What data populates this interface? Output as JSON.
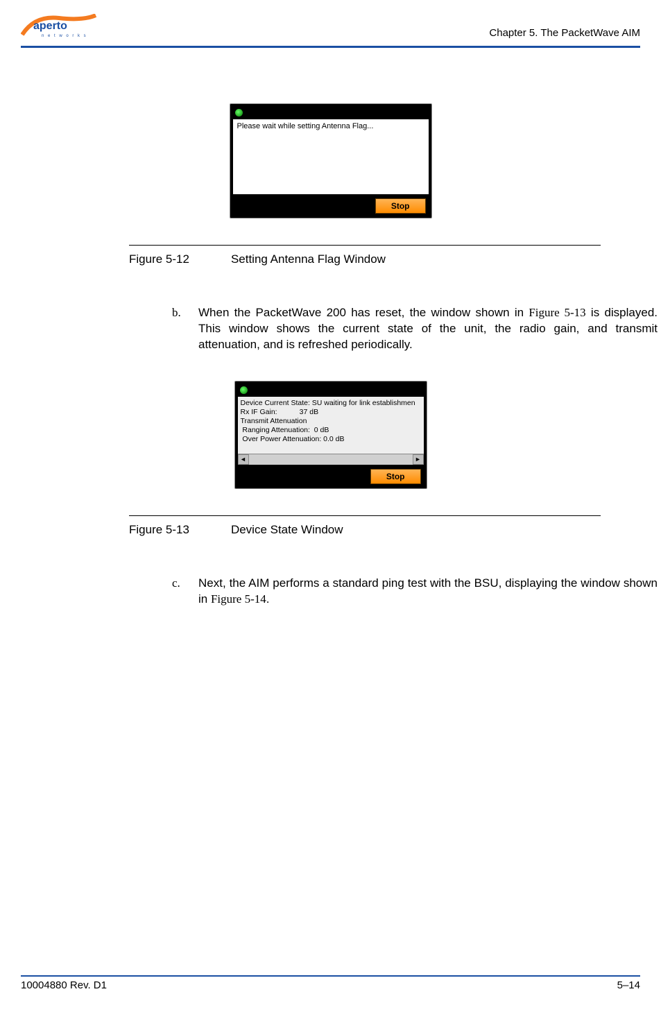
{
  "header": {
    "logo_main": "aperto",
    "logo_sub": "n e t w o r k s",
    "chapter": "Chapter 5.   The PacketWave AIM"
  },
  "figure1": {
    "message": "Please wait while setting Antenna Flag...",
    "stop": "Stop",
    "caption_num": "Figure 5-12",
    "caption_title": "Setting Antenna Flag Window"
  },
  "para_b": {
    "letter": "b.",
    "text_pre": "When the PacketWave 200 has reset, the window shown in ",
    "ref": "Figure 5-13",
    "text_post": " is displayed. This window shows the current state of the unit, the radio gain, and transmit attenuation, and is refreshed periodically."
  },
  "figure2": {
    "line1": "Device Current State: SU waiting for link establishmen",
    "line2": "Rx IF Gain:           37 dB",
    "line3": "Transmit Attenuation",
    "line4": " Ranging Attenuation:  0 dB",
    "line5": " Over Power Attenuation: 0.0 dB",
    "stop": "Stop",
    "caption_num": "Figure 5-13",
    "caption_title": "Device State Window"
  },
  "para_c": {
    "letter": "c.",
    "text_pre": "Next, the AIM performs a standard ping test with the BSU, displaying the window shown in ",
    "ref": "Figure 5-14",
    "text_post": "."
  },
  "footer": {
    "left": "10004880 Rev. D1",
    "right": "5–14"
  }
}
